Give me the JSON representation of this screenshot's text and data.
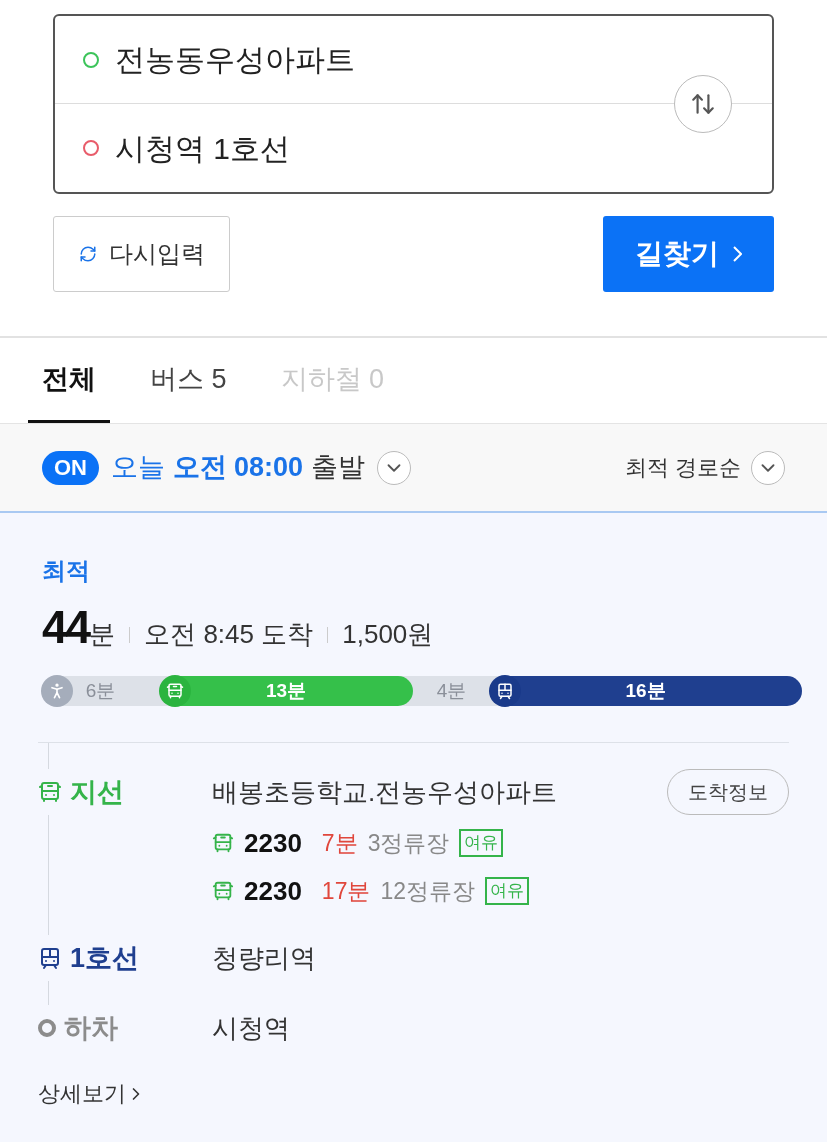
{
  "route_input": {
    "origin": "전농동우성아파트",
    "destination": "시청역 1호선"
  },
  "buttons": {
    "reset": "다시입력",
    "search": "길찾기"
  },
  "tabs": [
    {
      "label": "전체",
      "selected": true,
      "disabled": false
    },
    {
      "label": "버스 5",
      "selected": false,
      "disabled": false
    },
    {
      "label": "지하철 0",
      "selected": false,
      "disabled": true
    }
  ],
  "departure": {
    "toggle": "ON",
    "on": true,
    "time": "오늘 **오전 08:00**",
    "label": "출발",
    "sort": "최적 경로순"
  },
  "route": {
    "tag": "최적",
    "duration_value": "44",
    "duration_unit": "분",
    "arrival": "오전 8:45 도착",
    "fare": "1,500원",
    "segments": [
      {
        "kind": "walk",
        "label": "6분",
        "show_icon": true
      },
      {
        "kind": "bus",
        "label": "13분",
        "show_icon": true
      },
      {
        "kind": "walk",
        "label": "4분",
        "show_icon": false
      },
      {
        "kind": "subway",
        "label": "16분",
        "show_icon": true
      }
    ],
    "steps": [
      {
        "kind": "bus",
        "label": "지선",
        "color": "#35b44a",
        "place": "배봉초등학교.전농우성아파트",
        "action": "도착정보",
        "arrivals": [
          {
            "number": "2230",
            "wait": "7분",
            "stops": "3정류장",
            "crowd": "여유"
          },
          {
            "number": "2230",
            "wait": "17분",
            "stops": "12정류장",
            "crowd": "여유"
          }
        ]
      },
      {
        "kind": "subway",
        "label": "1호선",
        "color": "#1f3f8f",
        "place": "청량리역"
      },
      {
        "kind": "getoff",
        "label": "하차",
        "color": "#8c8c8c",
        "place": "시청역"
      }
    ],
    "details": "상세보기"
  }
}
